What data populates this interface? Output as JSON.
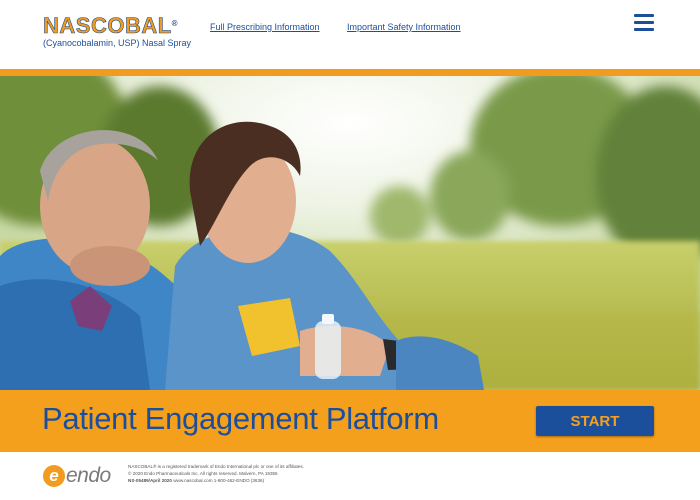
{
  "header": {
    "logo_name": "NASCOBAL",
    "logo_reg": "®",
    "logo_subtitle": "(Cyanocobalamin, USP) Nasal Spray",
    "links": [
      "Full Prescribing Information",
      "Important Safety Information"
    ],
    "menu_icon": "hamburger-menu-icon"
  },
  "hero": {
    "image_alt": "Couple in blue jackets sitting outdoors in a sunny park"
  },
  "banner": {
    "title": "Patient Engagement Platform",
    "start_label": "START"
  },
  "footer": {
    "endo_mark": "e",
    "endo_text": "endo",
    "legal_line1": "NASCOBAL® is a registered trademark of Endo International plc or one of its affiliates.",
    "legal_line2": "© 2020 Endo Pharmaceuticals Inc. All rights reserved. Malvern, PA 19355",
    "legal_code": "NS-05489/April 2020",
    "legal_contact": "www.nascobal.com 1-800-462-ENDO (3636)"
  },
  "colors": {
    "brand_blue": "#1b4f9c",
    "brand_orange": "#f29c1f",
    "banner_orange": "#f5a01c"
  }
}
